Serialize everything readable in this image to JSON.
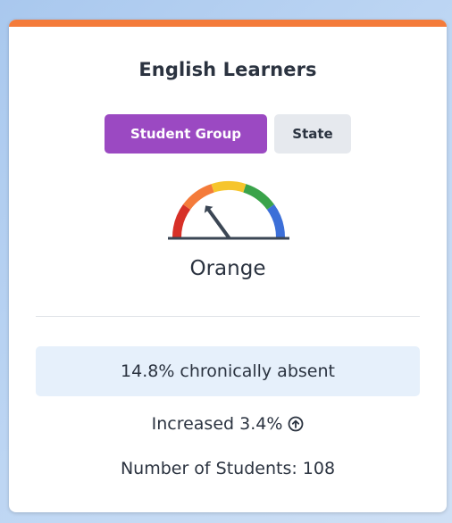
{
  "card": {
    "title": "English Learners",
    "accent_color": "#f47b3a"
  },
  "toggle": {
    "options": [
      {
        "label": "Student Group",
        "active": true
      },
      {
        "label": "State",
        "active": false
      }
    ],
    "active_color": "#9b49c2",
    "inactive_color": "#e6e9ee"
  },
  "gauge": {
    "level": "Orange",
    "segments": [
      "red",
      "orange",
      "yellow",
      "green",
      "blue"
    ],
    "segment_colors": [
      "#d73027",
      "#f47b3a",
      "#f6c52d",
      "#3aa34a",
      "#3c6fd8"
    ],
    "needle_position_level": 2,
    "needle_of_levels": 5,
    "icon": "gauge-icon"
  },
  "metric": {
    "text": "14.8% chronically absent"
  },
  "change": {
    "text": "Increased 3.4%",
    "icon": "arrow-up-circle-icon"
  },
  "students": {
    "text": "Number of Students: 108"
  }
}
